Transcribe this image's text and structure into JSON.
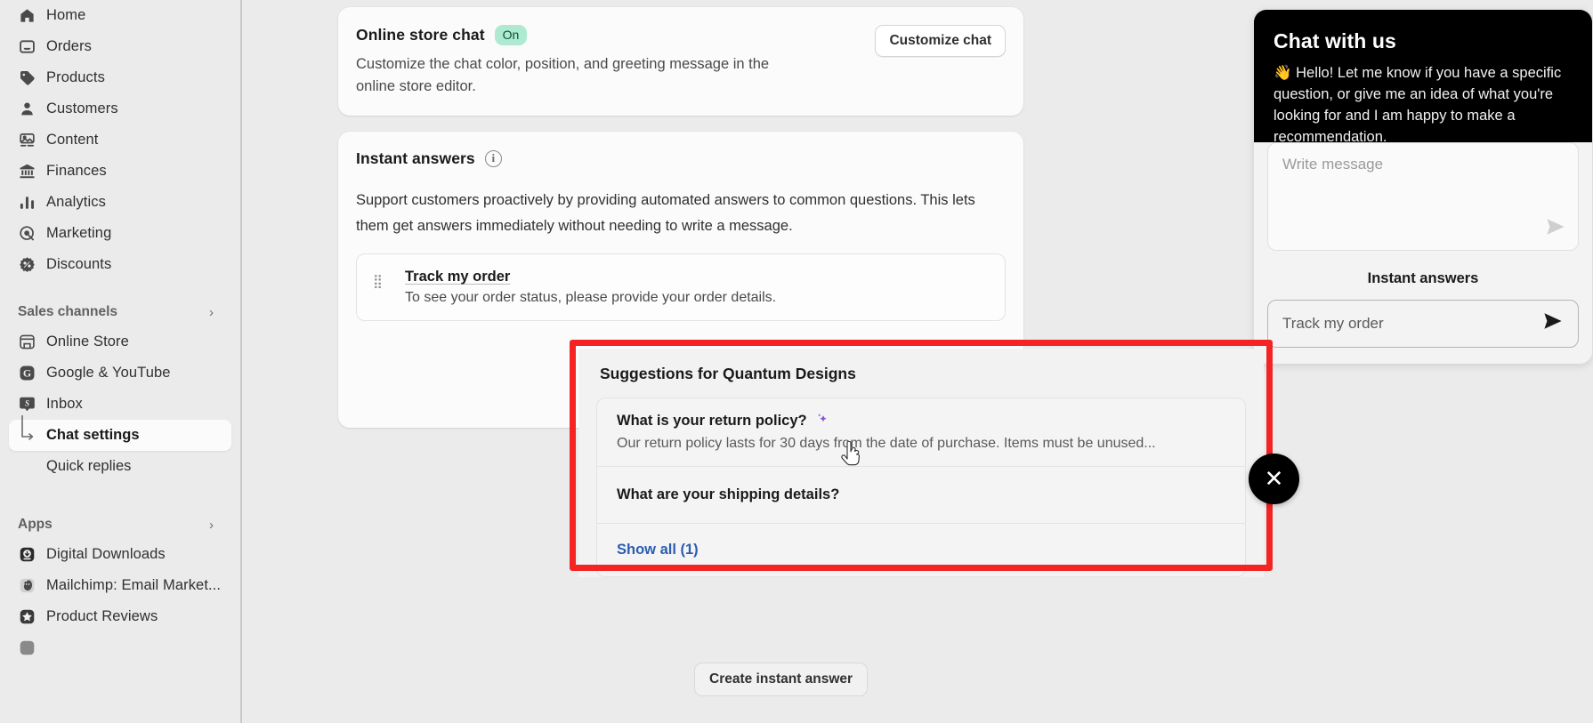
{
  "sidebar": {
    "main_items": [
      {
        "label": "Home",
        "icon": "home-icon"
      },
      {
        "label": "Orders",
        "icon": "orders-inbox-icon"
      },
      {
        "label": "Products",
        "icon": "product-tag-icon"
      },
      {
        "label": "Customers",
        "icon": "customer-person-icon"
      },
      {
        "label": "Content",
        "icon": "content-image-icon"
      },
      {
        "label": "Finances",
        "icon": "finances-bank-icon"
      },
      {
        "label": "Analytics",
        "icon": "analytics-bars-icon"
      },
      {
        "label": "Marketing",
        "icon": "marketing-target-icon"
      },
      {
        "label": "Discounts",
        "icon": "discount-percent-icon"
      }
    ],
    "sales_channels": {
      "title": "Sales channels",
      "items": [
        {
          "label": "Online Store",
          "icon": "online-store-icon"
        },
        {
          "label": "Google & YouTube",
          "icon": "google-icon"
        },
        {
          "label": "Inbox",
          "icon": "shopify-inbox-icon"
        }
      ],
      "sub_items": [
        {
          "label": "Chat settings",
          "active": true
        },
        {
          "label": "Quick replies",
          "active": false
        }
      ]
    },
    "apps": {
      "title": "Apps",
      "items": [
        {
          "label": "Digital Downloads",
          "icon": "digital-downloads-icon",
          "color": "#2b2b2b"
        },
        {
          "label": "Mailchimp: Email Market...",
          "icon": "mailchimp-icon",
          "color": "#4a4a4a"
        },
        {
          "label": "Product Reviews",
          "icon": "product-reviews-star-icon",
          "color": "#3a3a3a"
        }
      ]
    }
  },
  "online_store_chat": {
    "title": "Online store chat",
    "status_badge": "On",
    "description": "Customize the chat color, position, and greeting message in the online store editor.",
    "customize_button": "Customize chat"
  },
  "instant_answers": {
    "title": "Instant answers",
    "info_icon": "i",
    "description": "Support customers proactively by providing automated answers to common questions. This lets them get answers immediately without needing to write a message.",
    "items": [
      {
        "question": "Track my order",
        "answer": "To see your order status, please provide your order details."
      }
    ],
    "create_button": "Create instant answer"
  },
  "suggestions": {
    "heading": "Suggestions for Quantum Designs",
    "items": [
      {
        "question": "What is your return policy?",
        "has_sparkle": true,
        "answer": "Our return policy lasts for 30 days from the date of purchase. Items must be unused..."
      },
      {
        "question": "What are your shipping details?",
        "has_sparkle": false,
        "answer": ""
      }
    ],
    "show_all_link": "Show all (1)",
    "highlight_color": "#f42424"
  },
  "chat_widget": {
    "title": "Chat with us",
    "greeting": "👋 Hello! Let me know if you have a specific question, or give me an idea of what you're looking for and I am happy to make a recommendation.",
    "message_placeholder": "Write message",
    "send_icon": "send-arrow-icon",
    "instant_answers_label": "Instant answers",
    "quick_reply": "Track my order",
    "quick_reply_icon": "send-arrow-icon",
    "close_icon": "close-x-icon",
    "close_label": "✕"
  }
}
